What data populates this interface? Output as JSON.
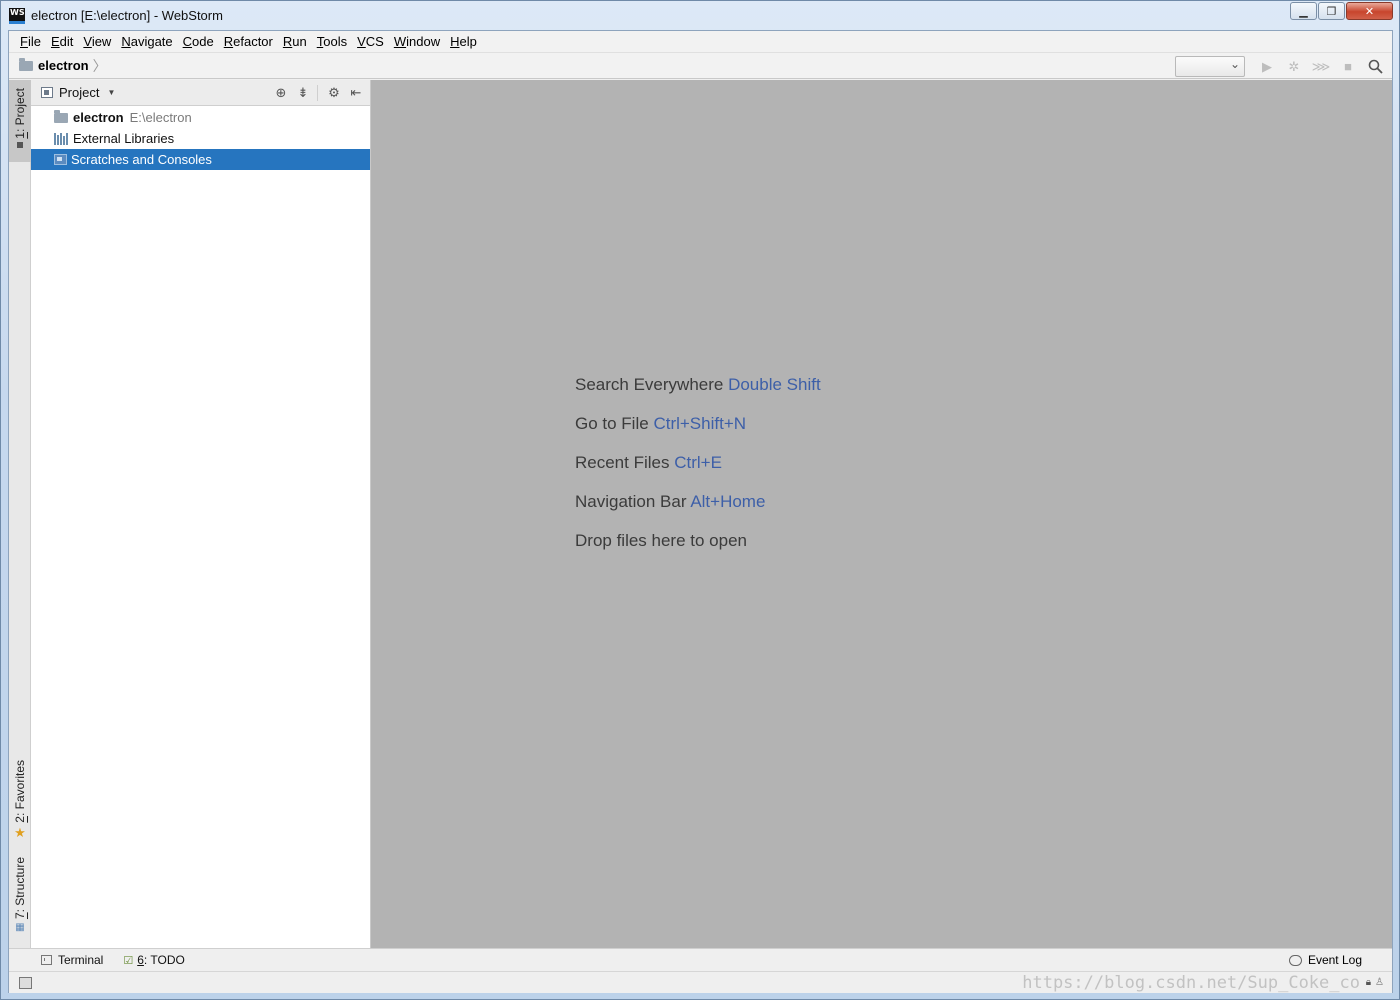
{
  "window": {
    "app_icon_text": "WS",
    "title": "electron [E:\\electron] - WebStorm",
    "controls": {
      "minimize": "▁",
      "maximize": "❐",
      "close": "✕"
    }
  },
  "menu": [
    {
      "mnemonic": "F",
      "rest": "ile"
    },
    {
      "mnemonic": "E",
      "rest": "dit"
    },
    {
      "mnemonic": "V",
      "rest": "iew"
    },
    {
      "mnemonic": "N",
      "rest": "avigate"
    },
    {
      "mnemonic": "C",
      "rest": "ode"
    },
    {
      "mnemonic": "R",
      "rest": "efactor"
    },
    {
      "mnemonic": "R",
      "rest": "un",
      "pre": ""
    },
    {
      "mnemonic": "T",
      "rest": "ools"
    },
    {
      "mnemonic": "V",
      "rest": "CS"
    },
    {
      "mnemonic": "W",
      "rest": "indow"
    },
    {
      "mnemonic": "H",
      "rest": "elp"
    }
  ],
  "navbar": {
    "breadcrumb": "electron",
    "separator": "〉",
    "icons": [
      "run-icon",
      "debug-icon",
      "coverage-icon",
      "stop-icon",
      "search-icon"
    ]
  },
  "left_strip": {
    "project_tab": {
      "mnemonic": "1",
      "rest": ": Project"
    },
    "favorites_tab": {
      "mnemonic": "2",
      "rest": ": Favorites"
    },
    "structure_tab": {
      "mnemonic": "7",
      "rest": ": Structure"
    }
  },
  "project_panel": {
    "title": "Project",
    "tools": [
      "locate-icon",
      "collapse-icon",
      "settings-icon",
      "hide-icon"
    ],
    "tree": [
      {
        "name": "electron",
        "path": "E:\\electron",
        "icon": "folder-icon"
      },
      {
        "name": "External Libraries",
        "icon": "library-icon"
      },
      {
        "name": "Scratches and Consoles",
        "icon": "scratch-icon",
        "selected": true
      }
    ]
  },
  "editor": {
    "hints": [
      {
        "text": "Search Everywhere",
        "key": "Double Shift"
      },
      {
        "text": "Go to File",
        "key": "Ctrl+Shift+N"
      },
      {
        "text": "Recent Files",
        "key": "Ctrl+E"
      },
      {
        "text": "Navigation Bar",
        "key": "Alt+Home"
      },
      {
        "text": "Drop files here to open",
        "key": ""
      }
    ]
  },
  "bottom_bar": {
    "terminal": "Terminal",
    "todo_mnemonic": "6",
    "todo_rest": ": TODO",
    "event_log": "Event Log"
  },
  "status_bar": {
    "watermark": "https://blog.csdn.net/Sup_Coke_co"
  },
  "colors": {
    "selection": "#2675bf",
    "editor_bg": "#b3b3b3",
    "shortcut_key": "#3d5fa8"
  }
}
